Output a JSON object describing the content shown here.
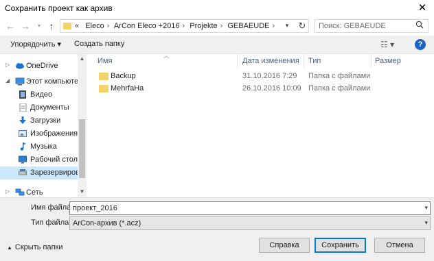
{
  "window": {
    "title": "Сохранить проект как архив"
  },
  "nav": {
    "breadcrumb": [
      "«",
      "Eleco",
      "ArCon Eleco +2016",
      "Projekte",
      "GEBAEUDE"
    ],
    "search_placeholder": "Поиск: GEBAEUDE"
  },
  "toolbar": {
    "organize": "Упорядочить ▾",
    "new_folder": "Создать папку"
  },
  "sidebar": {
    "items": [
      {
        "label": "OneDrive",
        "icon": "cloud-icon"
      },
      {
        "label": "Этот компьютер",
        "icon": "computer-icon"
      },
      {
        "label": "Видео",
        "icon": "video-icon"
      },
      {
        "label": "Документы",
        "icon": "documents-icon"
      },
      {
        "label": "Загрузки",
        "icon": "download-icon"
      },
      {
        "label": "Изображения",
        "icon": "pictures-icon"
      },
      {
        "label": "Музыка",
        "icon": "music-icon"
      },
      {
        "label": "Рабочий стол",
        "icon": "desktop-icon"
      },
      {
        "label": "Зарезервирован",
        "icon": "drive-icon"
      },
      {
        "label": "Сеть",
        "icon": "network-icon"
      }
    ]
  },
  "columns": {
    "name": "Имя",
    "date": "Дата изменения",
    "type": "Тип",
    "size": "Размер"
  },
  "files": [
    {
      "name": "Backup",
      "date": "31.10.2016 7:29",
      "type": "Папка с файлами"
    },
    {
      "name": "MehrfaHa",
      "date": "26.10.2016 10:09",
      "type": "Папка с файлами"
    }
  ],
  "form": {
    "filename_label": "Имя файла:",
    "filename_value": "проект_2016",
    "filetype_label": "Тип файла:",
    "filetype_value": "ArCon-архив (*.acz)"
  },
  "footer": {
    "hide_folders": "Скрыть папки",
    "save": "Справка",
    "ok": "Сохранить",
    "cancel": "Отмена"
  },
  "colors": {
    "accent": "#0078d7",
    "folder": "#f5d36b",
    "selection": "#cce8ff"
  }
}
